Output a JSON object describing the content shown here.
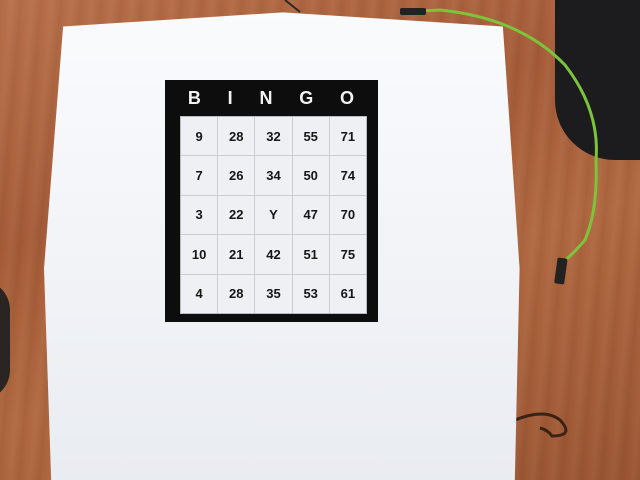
{
  "bingo": {
    "header": [
      "B",
      "I",
      "N",
      "G",
      "O"
    ],
    "rows": [
      [
        "9",
        "28",
        "32",
        "55",
        "71"
      ],
      [
        "7",
        "26",
        "34",
        "50",
        "74"
      ],
      [
        "3",
        "22",
        "Y",
        "47",
        "70"
      ],
      [
        "10",
        "21",
        "42",
        "51",
        "75"
      ],
      [
        "4",
        "28",
        "35",
        "53",
        "61"
      ]
    ]
  },
  "colors": {
    "table": "#a65c38",
    "paper": "#f4f6f9",
    "card_border": "#0d0d0d",
    "cable": "#7cc43a"
  }
}
